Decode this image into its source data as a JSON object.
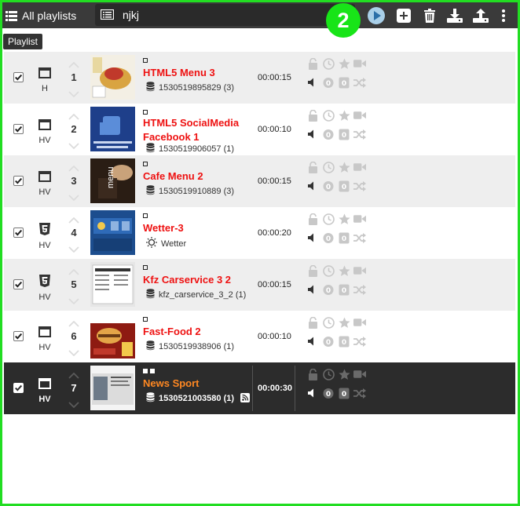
{
  "toolbar": {
    "all_playlists_label": "All playlists",
    "selected_playlist": "njkj",
    "badge_number": "2",
    "play_icon": "play-circle-icon",
    "add_icon": "plus-square-icon",
    "delete_icon": "trash-icon",
    "download_icon": "download-icon",
    "upload_icon": "upload-icon",
    "menu_icon": "more-vertical-icon"
  },
  "tooltip": "Playlist",
  "colors": {
    "accent_green": "#18e418",
    "title_red": "#ee1111",
    "title_orange": "#ff8822",
    "toolbar_bg": "#3a3a3a",
    "selected_row_bg": "#2c2c2c"
  },
  "items": [
    {
      "num": "1",
      "type_label": "H",
      "type_icon": "window-icon",
      "title": "HTML5 Menu 3",
      "source_icon": "database-icon",
      "source": "1530519895829 (3)",
      "duration": "00:00:15",
      "checked": true
    },
    {
      "num": "2",
      "type_label": "HV",
      "type_icon": "window-icon",
      "title": "HTML5 SocialMedia Facebook 1",
      "source_icon": "database-icon",
      "source": "1530519906057 (1)",
      "duration": "00:00:10",
      "checked": true
    },
    {
      "num": "3",
      "type_label": "HV",
      "type_icon": "window-icon",
      "title": "Cafe Menu 2",
      "source_icon": "database-icon",
      "source": "1530519910889 (3)",
      "duration": "00:00:15",
      "checked": true
    },
    {
      "num": "4",
      "type_label": "HV",
      "type_icon": "html5-icon",
      "title": "Wetter-3",
      "source_icon": "sun-icon",
      "source": "Wetter",
      "duration": "00:00:20",
      "checked": true
    },
    {
      "num": "5",
      "type_label": "HV",
      "type_icon": "html5-icon",
      "title": "Kfz Carservice 3 2",
      "source_icon": "database-icon",
      "source": "kfz_carservice_3_2 (1)",
      "duration": "00:00:15",
      "checked": true
    },
    {
      "num": "6",
      "type_label": "HV",
      "type_icon": "window-icon",
      "title": "Fast-Food 2",
      "source_icon": "database-icon",
      "source": "1530519938906 (1)",
      "duration": "00:00:10",
      "checked": true
    },
    {
      "num": "7",
      "type_label": "HV",
      "type_icon": "window-icon",
      "title": "News Sport",
      "source_icon": "database-icon",
      "source": "1530521003580 (1)",
      "duration": "00:00:30",
      "checked": true,
      "selected": true
    }
  ]
}
